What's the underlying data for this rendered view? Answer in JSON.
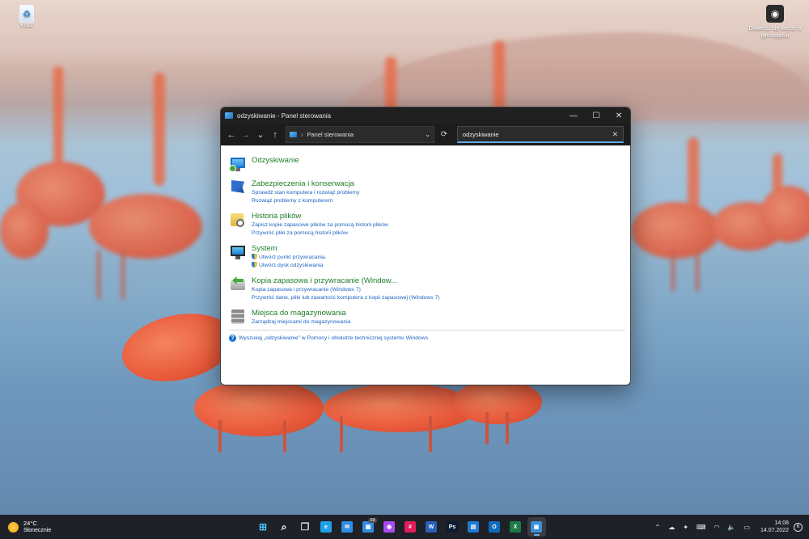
{
  "desktop": {
    "recycle_bin_label": "Kosz",
    "screenshot_icon_label": "Dowiedz się więcej o tym zdjęciu"
  },
  "window": {
    "title": "odzyskiwanie - Panel sterowania",
    "controls": {
      "minimize": "—",
      "maximize": "☐",
      "close": "✕"
    },
    "nav": {
      "back": "←",
      "forward": "→",
      "recent": "⌄",
      "up": "↑"
    },
    "address": {
      "separator": "›",
      "location": "Panel sterowania",
      "dropdown": "⌄",
      "refresh": "⟳"
    },
    "search": {
      "value": "odzyskiwanie",
      "clear": "✕"
    },
    "results": [
      {
        "title": "Odzyskiwanie",
        "links": [],
        "icon": "recovery-icon"
      },
      {
        "title": "Zabezpieczenia i konserwacja",
        "links": [
          "Sprawdź stan komputera i rozwiąż problemy",
          "Rozwiąż problemy z komputerem"
        ],
        "icon": "security-flag-icon"
      },
      {
        "title": "Historia plików",
        "links": [
          "Zapisz kopie zapasowe plików za pomocą historii plików",
          "Przywróć pliki za pomocą historii plików"
        ],
        "icon": "file-history-icon"
      },
      {
        "title": "System",
        "links": [
          "Utwórz punkt przywracania.",
          "Utwórz dysk odzyskiwania"
        ],
        "icon": "system-icon"
      },
      {
        "title": "Kopia zapasowa i przywracanie (Window...",
        "links": [
          "Kopia zapasowa i przywracanie (Windows 7)",
          "Przywróć dane, pliki lub zawartość komputera z kopii zapasowej (Windows 7)"
        ],
        "icon": "backup-restore-icon"
      },
      {
        "title": "Miejsca do magazynowania",
        "links": [
          "Zarządzaj miejscami do magazynowania"
        ],
        "icon": "storage-spaces-icon"
      }
    ],
    "help_text": "Wyszukaj „odzyskiwanie” w Pomocy i obsłudze technicznej systemu Windows",
    "help_glyph": "?"
  },
  "taskbar": {
    "weather": {
      "temp": "24°C",
      "condition": "Słonecznie"
    },
    "apps": [
      {
        "name": "start",
        "glyph": "⊞",
        "color": "#4cc2ff"
      },
      {
        "name": "search",
        "glyph": "⌕",
        "color": "#ffffff"
      },
      {
        "name": "task-view",
        "glyph": "❐",
        "color": "#d0d0d0"
      },
      {
        "name": "edge",
        "glyph": "e",
        "color": "#1ea1e6"
      },
      {
        "name": "mail",
        "glyph": "✉",
        "color": "#2f8de4"
      },
      {
        "name": "store",
        "glyph": "▦",
        "color": "#2f8de4",
        "badge": "19"
      },
      {
        "name": "messenger",
        "glyph": "◉",
        "color": "#a84bf0"
      },
      {
        "name": "slack",
        "glyph": "#",
        "color": "#e01e5a"
      },
      {
        "name": "word",
        "glyph": "W",
        "color": "#2b5fb8"
      },
      {
        "name": "photoshop",
        "glyph": "Ps",
        "color": "#0c1b35"
      },
      {
        "name": "trello",
        "glyph": "▤",
        "color": "#1f7ad6"
      },
      {
        "name": "outlook",
        "glyph": "O",
        "color": "#0f6cbd"
      },
      {
        "name": "excel",
        "glyph": "X",
        "color": "#1d7a45"
      },
      {
        "name": "control-panel",
        "glyph": "▣",
        "color": "#3c8ed8",
        "active": true
      }
    ],
    "tray": {
      "chevron": "⌃",
      "cloud": "☁",
      "app": "✦",
      "keyboard": "⌨",
      "wifi": "◠",
      "volume": "🔈",
      "battery": "▭"
    },
    "clock": {
      "time": "14:08",
      "date": "14.07.2022"
    },
    "notifications": "6"
  }
}
